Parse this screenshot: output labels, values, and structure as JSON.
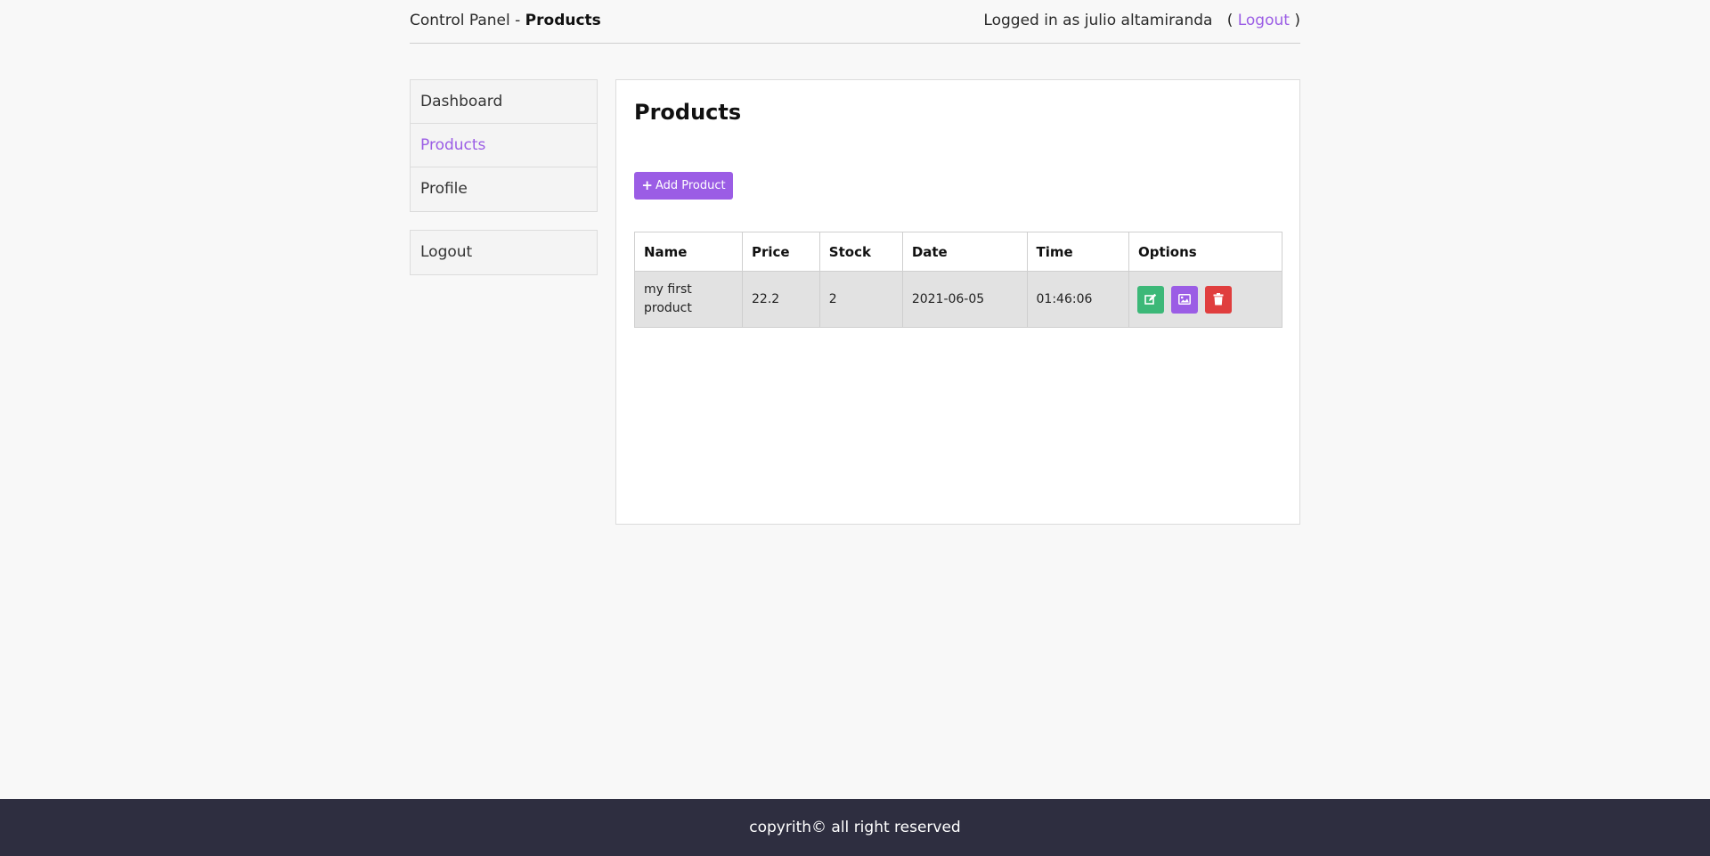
{
  "header": {
    "prefix": "Control Panel - ",
    "section": "Products",
    "logged_in_prefix": "Logged in as julio altamiranda",
    "paren_open": "(",
    "logout_link": "Logout",
    "paren_close": ")"
  },
  "sidebar": {
    "items": [
      {
        "label": "Dashboard",
        "active": false
      },
      {
        "label": "Products",
        "active": true
      },
      {
        "label": "Profile",
        "active": false
      }
    ],
    "logout": "Logout"
  },
  "main": {
    "title": "Products",
    "add_button": "Add Product",
    "table": {
      "columns": [
        "Name",
        "Price",
        "Stock",
        "Date",
        "Time",
        "Options"
      ],
      "rows": [
        {
          "name": "my first product",
          "price": "22.2",
          "stock": "2",
          "date": "2021-06-05",
          "time": "01:46:06"
        }
      ]
    },
    "options_icons": [
      "edit-icon",
      "image-icon",
      "trash-icon"
    ]
  },
  "footer": {
    "text": "copyrith© all right reserved"
  },
  "colors": {
    "accent": "#9b5de5",
    "edit": "#3cb878",
    "delete": "#e03e3e",
    "footer_bg": "#2e2e40"
  }
}
